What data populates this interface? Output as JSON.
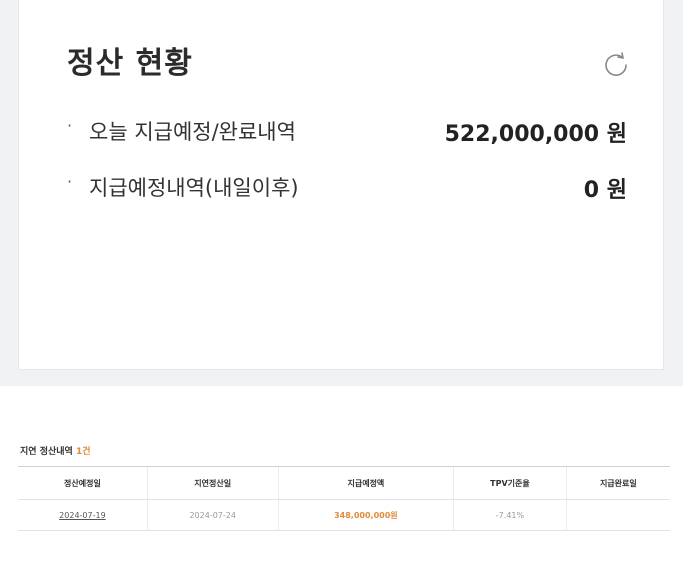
{
  "summary": {
    "title": "정산 현황",
    "refresh_icon": "refresh-icon",
    "rows": [
      {
        "bullet": "·",
        "label": "오늘 지급예정/완료내역",
        "amount": "522,000,000 원"
      },
      {
        "bullet": "·",
        "label": "지급예정내역(내일이후)",
        "amount": "0 원"
      }
    ]
  },
  "delay": {
    "title": "지연 정산내역",
    "count": "1건",
    "columns": [
      "정산예정일",
      "지연정산일",
      "지급예정액",
      "TPV기준율",
      "지급완료일"
    ],
    "rows": [
      {
        "scheduled": "2024-07-19",
        "delayed": "2024-07-24",
        "amount": "348,000,000원",
        "tpv": "-7.41%",
        "completed": ""
      }
    ]
  },
  "colors": {
    "accent": "#e08a3a",
    "background": "#f1f2f4"
  }
}
